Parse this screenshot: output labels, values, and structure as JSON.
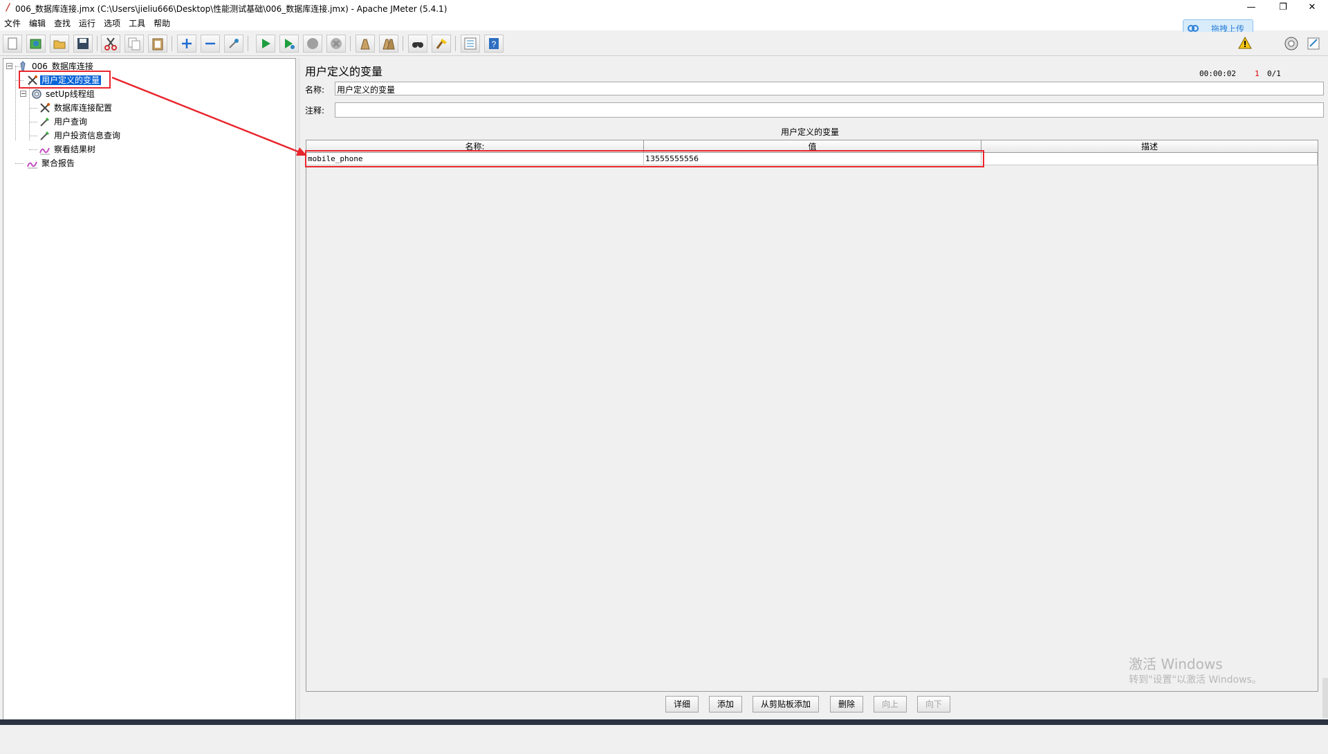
{
  "window": {
    "title": "006_数据库连接.jmx (C:\\Users\\jieliu666\\Desktop\\性能测试基础\\006_数据库连接.jmx) - Apache JMeter (5.4.1)",
    "minimize": "—",
    "restore": "❐",
    "close": "✕"
  },
  "menu": [
    "文件",
    "编辑",
    "查找",
    "运行",
    "选项",
    "工具",
    "帮助"
  ],
  "upload": {
    "label": "拖拽上传"
  },
  "status": {
    "elapsed": "00:00:02",
    "warnings": "1",
    "threads": "0/1"
  },
  "toolbar_icons": [
    "new-icon",
    "templates-icon",
    "open-icon",
    "save-icon",
    "cut-icon",
    "copy-icon",
    "paste-icon",
    "expand-icon",
    "collapse-icon",
    "toggle-icon",
    "start-icon",
    "start-no-pause-icon",
    "stop-icon",
    "shutdown-icon",
    "clear-icon",
    "clear-all-icon",
    "search-icon",
    "reset-search-icon",
    "function-helper-icon",
    "help-icon"
  ],
  "tree": {
    "root": "006_数据库连接",
    "items": [
      {
        "label": "用户定义的变量",
        "icon": "config-icon",
        "selected": true
      },
      {
        "label": "setUp线程组",
        "icon": "thread-group-icon"
      },
      {
        "label": "数据库连接配置",
        "icon": "config-icon"
      },
      {
        "label": "用户查询",
        "icon": "sampler-icon"
      },
      {
        "label": "用户投资信息查询",
        "icon": "sampler-icon"
      },
      {
        "label": "察看结果树",
        "icon": "listener-icon"
      },
      {
        "label": "聚合报告",
        "icon": "listener-icon"
      }
    ]
  },
  "panel": {
    "title": "用户定义的变量",
    "name_label": "名称:",
    "name_value": "用户定义的变量",
    "comment_label": "注释:",
    "comment_value": "",
    "table_title": "用户定义的变量",
    "columns": [
      "名称:",
      "值",
      "描述"
    ],
    "rows": [
      {
        "name": "mobile_phone",
        "value": "13555555556",
        "description": ""
      }
    ]
  },
  "buttons": [
    {
      "label": "详细",
      "enabled": true
    },
    {
      "label": "添加",
      "enabled": true
    },
    {
      "label": "从剪贴板添加",
      "enabled": true
    },
    {
      "label": "删除",
      "enabled": true
    },
    {
      "label": "向上",
      "enabled": false
    },
    {
      "label": "向下",
      "enabled": false
    }
  ],
  "watermark": {
    "line1": "激活 Windows",
    "line2": "转到\"设置\"以激活 Windows。"
  },
  "colors": {
    "selection": "#0a64d7",
    "annotation": "#e8262d"
  }
}
